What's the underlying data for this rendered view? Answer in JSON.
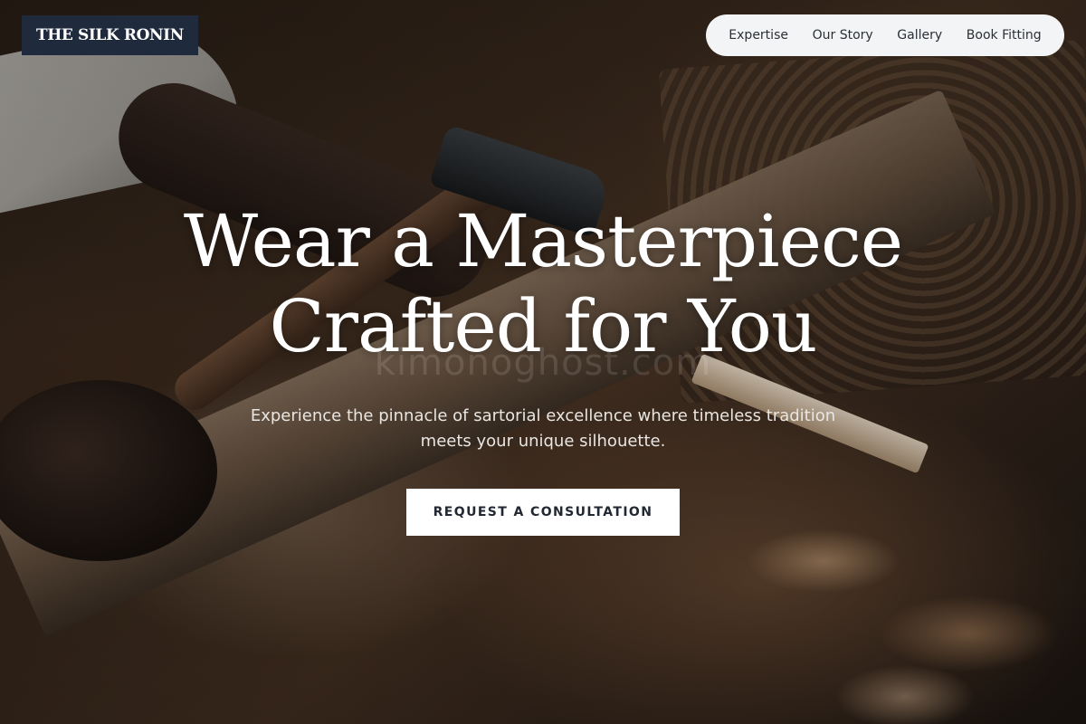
{
  "brand": {
    "name": "THE SILK RONIN"
  },
  "nav": {
    "items": [
      {
        "label": "Expertise"
      },
      {
        "label": "Our Story"
      },
      {
        "label": "Gallery"
      },
      {
        "label": "Book Fitting"
      }
    ]
  },
  "hero": {
    "title_line1": "Wear a Masterpiece",
    "title_line2": "Crafted for You",
    "watermark": "kimonoghost.com",
    "subtitle": "Experience the pinnacle of sartorial excellence where timeless tradition meets your unique silhouette.",
    "cta_label": "REQUEST A CONSULTATION"
  },
  "colors": {
    "brand_background": "#1f2a3c",
    "nav_background": "#f3f4f6",
    "cta_background": "#ffffff",
    "cta_text": "#222831"
  }
}
